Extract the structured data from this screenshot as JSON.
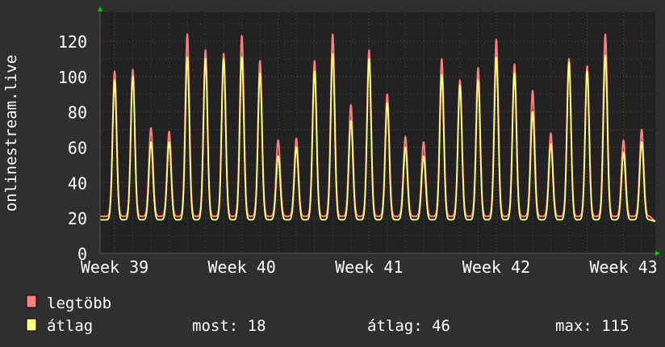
{
  "chart_data": {
    "type": "line",
    "title": "",
    "ylabel": "onlinestream.live",
    "xlabel": "",
    "ylim": [
      0,
      130
    ],
    "yticks": [
      "0",
      "20",
      "40",
      "60",
      "80",
      "100",
      "120"
    ],
    "ytick_values": [
      0,
      20,
      40,
      60,
      80,
      100,
      120
    ],
    "xticks": [
      "Week 39",
      "Week 40",
      "Week 41",
      "Week 42",
      "Week 43"
    ],
    "xtick_days": [
      0,
      7,
      14,
      21,
      28
    ],
    "xlim_days": [
      -0.8,
      29.75
    ],
    "grid": true,
    "legend_placement": "bottom-left",
    "series": [
      {
        "name": "legtöbb",
        "color": "#ff7f7f",
        "daily_peaks": [
          103,
          104,
          71,
          69,
          124,
          115,
          113,
          123,
          109,
          64,
          65,
          109,
          124,
          84,
          115,
          90,
          66,
          63,
          110,
          98,
          105,
          121,
          107,
          92,
          68,
          110,
          106,
          124,
          64,
          70
        ],
        "trough": 21
      },
      {
        "name": "átlag",
        "color": "#ffff7f",
        "daily_peaks": [
          98,
          100,
          63,
          63,
          111,
          110,
          110,
          111,
          102,
          55,
          60,
          103,
          113,
          75,
          110,
          85,
          60,
          55,
          101,
          95,
          98,
          111,
          102,
          80,
          62,
          108,
          103,
          112,
          57,
          63
        ],
        "trough": 19
      }
    ],
    "last_value": 18
  },
  "legend": {
    "items": [
      {
        "label": "legtöbb",
        "color": "#ff7f7f"
      },
      {
        "label": "átlag",
        "color": "#ffff7f"
      }
    ],
    "stats": {
      "now": "most: 18",
      "avg": "átlag: 46",
      "max": "max: 115"
    }
  }
}
